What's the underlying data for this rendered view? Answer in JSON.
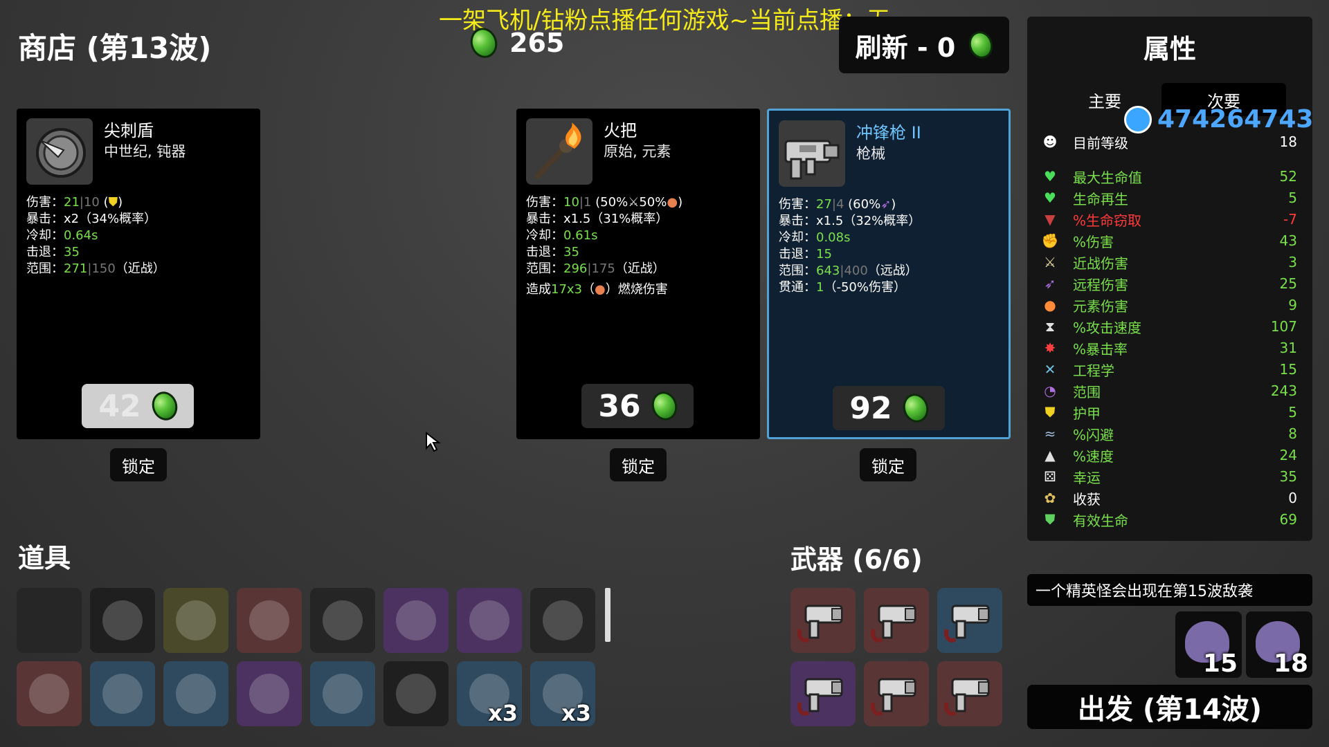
{
  "banner": "一架飞机/钻粉点播任何游戏~当前点播：无",
  "shop": {
    "title": "商店 (第13波)",
    "gold": "265",
    "refresh_label": "刷新 - 0"
  },
  "cards": [
    {
      "name": "尖刺盾",
      "type": "中世纪, 钝器",
      "damage": {
        "label": "伤害：",
        "value": "21",
        "sep": "|",
        "base": "10",
        "extra": " (",
        "extra_end": ")"
      },
      "crit": {
        "label": "暴击：",
        "value": "x2",
        "extra": "（34%概率）"
      },
      "cooldown": {
        "label": "冷却：",
        "value": "0.64s"
      },
      "knockback": {
        "label": "击退：",
        "value": "35"
      },
      "range": {
        "label": "范围：",
        "value": "271",
        "sep": "|",
        "base": "150",
        "extra": "（近战）"
      },
      "price": "42",
      "lock": "锁定",
      "price_style": "owned",
      "icon": "spiked-shield-icon"
    },
    {
      "name": "火把",
      "type": "原始, 元素",
      "damage": {
        "label": "伤害：",
        "value": "10",
        "sep": "|",
        "base": "1",
        "extra": " (50%",
        "extra_mid": "50%",
        "extra_end": ")"
      },
      "crit": {
        "label": "暴击：",
        "value": "x1.5",
        "extra": "（31%概率）"
      },
      "cooldown": {
        "label": "冷却：",
        "value": "0.61s"
      },
      "knockback": {
        "label": "击退：",
        "value": "35"
      },
      "range": {
        "label": "范围：",
        "value": "296",
        "sep": "|",
        "base": "175",
        "extra": "（近战）"
      },
      "special": {
        "prefix": "造成",
        "value": "17x3",
        "suffix": "（",
        "end": "）燃烧伤害"
      },
      "price": "36",
      "lock": "锁定",
      "price_style": "normal",
      "icon": "torch-icon"
    },
    {
      "name": "冲锋枪 II",
      "type": "枪械",
      "damage": {
        "label": "伤害：",
        "value": "27",
        "sep": "|",
        "base": "4",
        "extra": " (60%",
        "extra_end": ")"
      },
      "crit": {
        "label": "暴击：",
        "value": "x1.5",
        "extra": "（32%概率）"
      },
      "cooldown": {
        "label": "冷却：",
        "value": "0.08s"
      },
      "knockback": {
        "label": "击退：",
        "value": "15"
      },
      "range": {
        "label": "范围：",
        "value": "643",
        "sep": "|",
        "base": "400",
        "extra": "（远战）"
      },
      "pierce": {
        "label": "贯通：",
        "value": "1",
        "extra": "（-50%伤害）"
      },
      "price": "92",
      "lock": "锁定",
      "price_style": "normal",
      "icon": "smg-icon"
    }
  ],
  "items": {
    "title": "道具"
  },
  "item_slots": [
    {
      "icon": "empty-slot",
      "bg": "#262626"
    },
    {
      "icon": "mustache-egg-icon",
      "bg": "#1f1f1f"
    },
    {
      "icon": "sunglasses-egg-icon",
      "bg": "#4a4a2a"
    },
    {
      "icon": "rainbow-leaf-icon",
      "bg": "#5a3535"
    },
    {
      "icon": "claw-tree-icon",
      "bg": "#252525"
    },
    {
      "icon": "red-bandana-icon",
      "bg": "#4b3260"
    },
    {
      "icon": "mushroom-icon",
      "bg": "#4b3260"
    },
    {
      "icon": "snail-icon",
      "bg": "#252525"
    },
    {
      "icon": "stomach-icon",
      "bg": "#5a3535"
    },
    {
      "icon": "bullet-icon",
      "bg": "#2f4a5e"
    },
    {
      "icon": "rabbit-icon",
      "bg": "#2f4a5e"
    },
    {
      "icon": "zombie-head-icon",
      "bg": "#4b3260"
    },
    {
      "icon": "robot-arm-icon",
      "bg": "#2f4a5e"
    },
    {
      "icon": "rubber-duck-icon",
      "bg": "#1f1f1f"
    },
    {
      "icon": "red-flag-icon",
      "bg": "#2f4a5e",
      "count": "x3"
    },
    {
      "icon": "chainmail-icon",
      "bg": "#2f4a5e",
      "count": "x3"
    }
  ],
  "weapons": {
    "title": "武器 (6/6)"
  },
  "weapon_slots": [
    {
      "icon": "smg-icon",
      "bg": "#5a3535"
    },
    {
      "icon": "smg-icon",
      "bg": "#5a3535"
    },
    {
      "icon": "smg-icon",
      "bg": "#2f4a5e"
    },
    {
      "icon": "smg-icon",
      "bg": "#4b3260"
    },
    {
      "icon": "smg-icon",
      "bg": "#5a3535"
    },
    {
      "icon": "smg-icon",
      "bg": "#5a3535"
    }
  ],
  "stats": {
    "title": "属性",
    "tab_primary": "主要",
    "tab_secondary": "次要",
    "qq_number": "474264743",
    "level_label": "目前等级",
    "level_value": "18",
    "rows": [
      {
        "label": "最大生命值",
        "value": "52",
        "color": "green",
        "icon": "heart-icon"
      },
      {
        "label": "生命再生",
        "value": "5",
        "color": "green",
        "icon": "heart-plus-icon"
      },
      {
        "label": "%生命窃取",
        "value": "-7",
        "color": "red",
        "icon": "fangs-icon"
      },
      {
        "label": "%伤害",
        "value": "43",
        "color": "green",
        "icon": "muscle-icon"
      },
      {
        "label": "近战伤害",
        "value": "3",
        "color": "green",
        "icon": "sword-icon"
      },
      {
        "label": "远程伤害",
        "value": "25",
        "color": "green",
        "icon": "bow-icon"
      },
      {
        "label": "元素伤害",
        "value": "9",
        "color": "green",
        "icon": "flame-icon"
      },
      {
        "label": "%攻击速度",
        "value": "107",
        "color": "green",
        "icon": "hourglass-icon"
      },
      {
        "label": "%暴击率",
        "value": "31",
        "color": "green",
        "icon": "crit-icon"
      },
      {
        "label": "工程学",
        "value": "15",
        "color": "green",
        "icon": "wrench-icon"
      },
      {
        "label": "范围",
        "value": "243",
        "color": "green",
        "icon": "range-icon"
      },
      {
        "label": "护甲",
        "value": "5",
        "color": "green",
        "icon": "shield-icon"
      },
      {
        "label": "%闪避",
        "value": "8",
        "color": "green",
        "icon": "dodge-icon"
      },
      {
        "label": "%速度",
        "value": "24",
        "color": "green",
        "icon": "boot-icon"
      },
      {
        "label": "幸运",
        "value": "35",
        "color": "green",
        "icon": "dice-icon"
      },
      {
        "label": "收获",
        "value": "0",
        "color": "white",
        "icon": "harvest-icon"
      },
      {
        "label": "有效生命",
        "value": "69",
        "color": "green",
        "icon": "health-shield-icon"
      }
    ]
  },
  "notice": "一个精英怪会出现在第15波敌袭",
  "enemies": [
    {
      "count": "15",
      "icon": "elite-skull-icon"
    },
    {
      "count": "18",
      "icon": "boss-skull-icon"
    }
  ],
  "go_button": "出发 (第14波)",
  "colors": {
    "stat_green": "#79e04a",
    "stat_red": "#ff3a3a",
    "banner_yellow": "#f5ea1a",
    "selected_border": "#4fa3d6"
  }
}
